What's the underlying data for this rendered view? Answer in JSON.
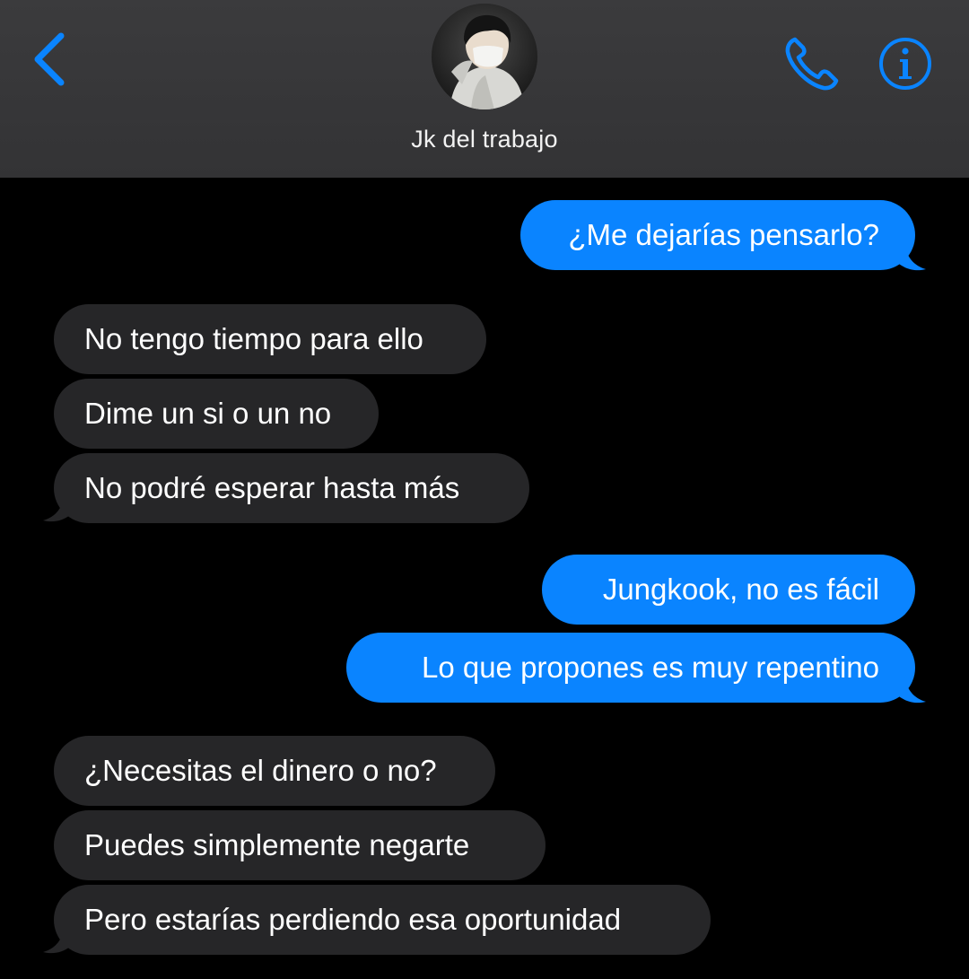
{
  "header": {
    "contact_name": "Jk del trabajo",
    "back_icon": "chevron-left-icon",
    "call_icon": "phone-icon",
    "info_icon": "info-icon",
    "accent_color": "#0a84ff",
    "background_color": "#363638"
  },
  "messages": [
    {
      "direction": "sent",
      "text": "¿Me dejarías pensarlo?"
    },
    {
      "direction": "received",
      "text": "No tengo tiempo para ello"
    },
    {
      "direction": "received",
      "text": "Dime un si o un no"
    },
    {
      "direction": "received",
      "text": "No podré esperar hasta más"
    },
    {
      "direction": "sent",
      "text": "Jungkook, no es fácil"
    },
    {
      "direction": "sent",
      "text": "Lo que propones es muy repentino"
    },
    {
      "direction": "received",
      "text": "¿Necesitas el dinero o no?"
    },
    {
      "direction": "received",
      "text": "Puedes simplemente negarte"
    },
    {
      "direction": "received",
      "text": "Pero estarías perdiendo esa oportunidad"
    }
  ],
  "colors": {
    "sent_bubble": "#0a84ff",
    "received_bubble": "#262628",
    "background": "#000000"
  }
}
